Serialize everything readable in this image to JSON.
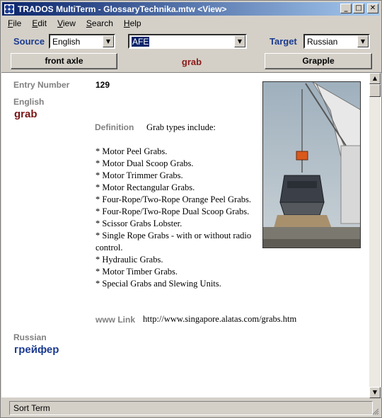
{
  "window": {
    "title": "TRADOS MultiTerm - GlossaryTechnika.mtw <View>",
    "buttons": {
      "minimize": "_",
      "maximize": "□",
      "close": "✕"
    }
  },
  "menu": [
    {
      "label": "File",
      "hotkey": "F",
      "rest": "ile"
    },
    {
      "label": "Edit",
      "hotkey": "E",
      "rest": "dit"
    },
    {
      "label": "View",
      "hotkey": "V",
      "rest": "iew"
    },
    {
      "label": "Search",
      "hotkey": "S",
      "rest": "earch"
    },
    {
      "label": "Help",
      "hotkey": "H",
      "rest": "elp"
    }
  ],
  "toolbar": {
    "source_label": "Source",
    "source_value": "English",
    "term_value": "AFE",
    "target_label": "Target",
    "target_value": "Russian"
  },
  "nav": {
    "prev_term": "front axle",
    "current_term": "grab",
    "next_term": "Grapple"
  },
  "entry": {
    "number_label": "Entry Number",
    "number": "129",
    "source_language": "English",
    "source_term": "grab",
    "definition_label": "Definition",
    "definition_intro": "Grab types include:",
    "definition_items": [
      "* Motor Peel Grabs.",
      "* Motor Dual Scoop Grabs.",
      "* Motor Trimmer Grabs.",
      "* Motor Rectangular Grabs.",
      "* Four-Rope/Two-Rope Orange Peel Grabs.",
      "* Four-Rope/Two-Rope Dual Scoop Grabs.",
      "* Scissor Grabs Lobster.",
      "* Single Rope Grabs - with or without radio control.",
      "* Hydraulic Grabs.",
      "* Motor Timber Grabs.",
      "* Special Grabs and Slewing Units."
    ],
    "link_label": "www Link",
    "link_value": "http://www.singapore.alatas.com/grabs.htm",
    "target_language": "Russian",
    "target_term": "грейфер"
  },
  "statusbar": {
    "text": "Sort Term"
  },
  "colors": {
    "title_gradient_start": "#0a246a",
    "label_blue": "#1a3a8f",
    "term_red": "#7a1515"
  }
}
